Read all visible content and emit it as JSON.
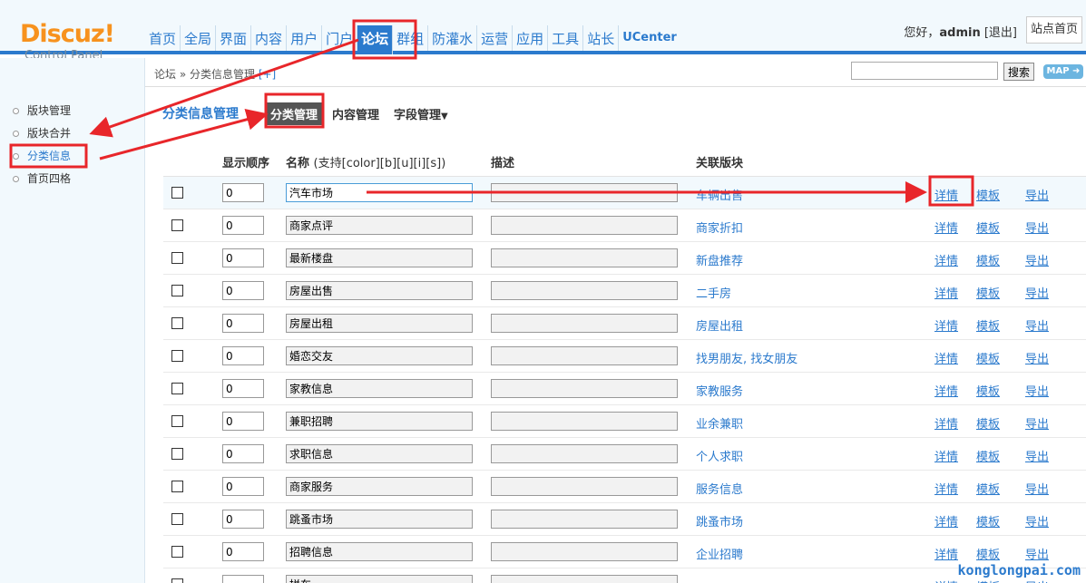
{
  "header": {
    "logo_brand": "Discuz!",
    "logo_sub": "Control Panel",
    "nav": [
      "首页",
      "全局",
      "界面",
      "内容",
      "用户",
      "门户",
      "论坛",
      "群组",
      "防灌水",
      "运营",
      "应用",
      "工具",
      "站长",
      "UCenter"
    ],
    "active_nav": "论坛",
    "greeting": "您好，",
    "username": "admin",
    "logout": "[退出]",
    "home_button": "站点首页"
  },
  "subbar": {
    "breadcrumb": "论坛 » 分类信息管理",
    "breadcrumb_plus": "[+]",
    "search_value": "",
    "search_button": "搜索",
    "map_button": "MAP ➜"
  },
  "sidebar": {
    "items": [
      "版块管理",
      "版块合并",
      "分类信息",
      "首页四格"
    ],
    "active": "分类信息"
  },
  "main": {
    "title": "分类信息管理",
    "tabs": [
      "分类管理",
      "内容管理",
      "字段管理"
    ],
    "tab_caret": "▼",
    "columns": {
      "order": "显示顺序",
      "name": "名称",
      "name_note": "(支持[color][b][u][i][s])",
      "desc": "描述",
      "forum": "关联版块"
    },
    "ops": {
      "detail": "详情",
      "template": "模板",
      "export": "导出"
    },
    "rows": [
      {
        "order": "0",
        "name": "汽车市场",
        "forum": "车辆出售"
      },
      {
        "order": "0",
        "name": "商家点评",
        "forum": "商家折扣"
      },
      {
        "order": "0",
        "name": "最新楼盘",
        "forum": "新盘推荐"
      },
      {
        "order": "0",
        "name": "房屋出售",
        "forum": "二手房"
      },
      {
        "order": "0",
        "name": "房屋出租",
        "forum": "房屋出租"
      },
      {
        "order": "0",
        "name": "婚恋交友",
        "forum": "找男朋友, 找女朋友"
      },
      {
        "order": "0",
        "name": "家教信息",
        "forum": "家教服务"
      },
      {
        "order": "0",
        "name": "兼职招聘",
        "forum": "业余兼职"
      },
      {
        "order": "0",
        "name": "求职信息",
        "forum": "个人求职"
      },
      {
        "order": "0",
        "name": "商家服务",
        "forum": "服务信息"
      },
      {
        "order": "0",
        "name": "跳蚤市场",
        "forum": "跳蚤市场"
      },
      {
        "order": "0",
        "name": "招聘信息",
        "forum": "企业招聘"
      },
      {
        "order": "",
        "name": "拼车",
        "forum": ""
      }
    ]
  },
  "watermark": "konglongpai.com",
  "colors": {
    "accent": "#2b7acd",
    "logo": "#f7921e",
    "annotation": "#e8262a"
  }
}
